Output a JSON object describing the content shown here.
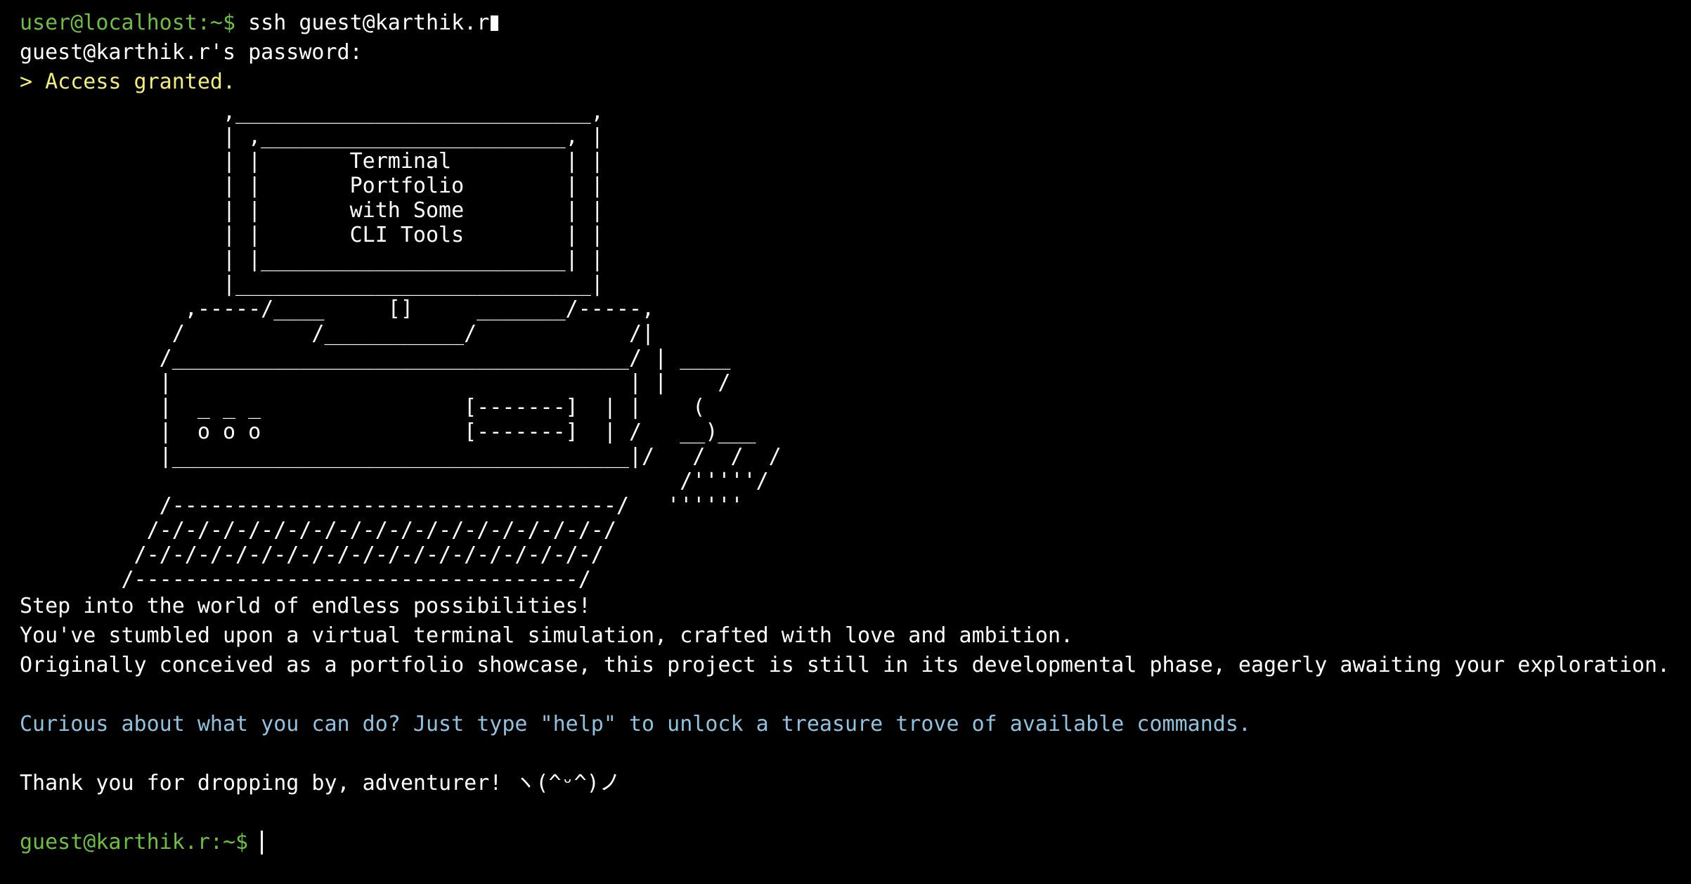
{
  "session": {
    "local_prompt": "user@localhost:~$",
    "ssh_command": "ssh guest@karthik.r",
    "password_prompt": "guest@karthik.r's password:",
    "access_message": "> Access granted."
  },
  "banner_art": "                ,____________________________,\n                | ,________________________, |\n                | |       Terminal         | |\n                | |       Portfolio        | |\n                | |       with Some        | |\n                | |       CLI Tools        | |\n                | |________________________| |\n                |____________________________|\n             ,-----/____     []     _______/-----,\n            /          /___________/            /|\n           /____________________________________/ | ____\n           |                                    | |    /\n           |  _ _ _                [-------]  | |    (\n           |  o o o                [-------]  | /   __)___\n           |____________________________________|/   /  /  /\n                                                    /'''''/\n           /-----------------------------------/   ''''''\n          /-/-/-/-/-/-/-/-/-/-/-/-/-/-/-/-/-/-/\n         /-/-/-/-/-/-/-/-/-/-/-/-/-/-/-/-/-/-/\n        /-----------------------------------/",
  "welcome": {
    "line1": "Step into the world of endless possibilities!",
    "line2": "You've stumbled upon a virtual terminal simulation, crafted with love and ambition.",
    "line3": "Originally conceived as a portfolio showcase, this project is still in its developmental phase, eagerly awaiting your exploration.",
    "help_hint": "Curious about what you can do? Just type \"help\" to unlock a treasure trove of available commands.",
    "thanks": "Thank you for dropping by, adventurer! ヽ(^ᵕ^)ノ"
  },
  "prompt": {
    "text": "guest@karthik.r:~$",
    "input_value": ""
  },
  "colors": {
    "background": "#000000",
    "text": "#ffffff",
    "prompt_green": "#6cbf3f",
    "granted_yellow": "#f4ee79",
    "hint_cyan": "#8ec2df"
  }
}
